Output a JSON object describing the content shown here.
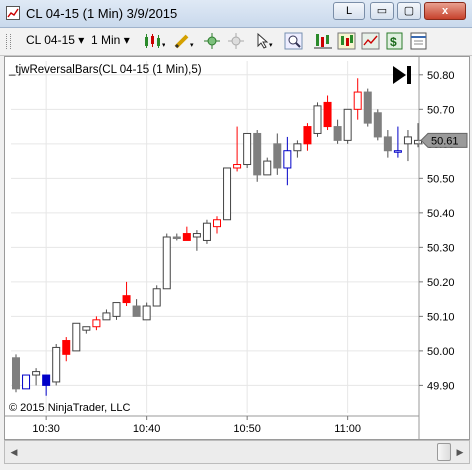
{
  "window": {
    "title": "CL 04-15 (1 Min)  3/9/2015",
    "lock_label": "L",
    "minimize_label": "▭",
    "maximize_label": "▢",
    "close_label": "x"
  },
  "toolbar": {
    "instrument": "CL 04-15",
    "interval": "1 Min",
    "icons": [
      "bar-type-icon",
      "drawing-tools-icon",
      "crosshair-icon",
      "global-crosshair-icon",
      "selection-pointer-icon",
      "zoom-icon",
      "indicators-icon",
      "strategies-icon",
      "chart-properties-icon",
      "dollar-icon",
      "data-box-icon"
    ]
  },
  "chart": {
    "indicator_label": "_tjwReversalBars(CL 04-15 (1 Min),5)",
    "copyright": "© 2015 NinjaTrader, LLC",
    "current_price_label": "50.61",
    "colors": {
      "up_body": "#ffffff",
      "down_body": "#7f7f7f",
      "reversal_up": "#ff0000",
      "reversal_down": "#0000c8",
      "wick": "#505050",
      "grid": "#e6e6e6"
    }
  },
  "chart_data": {
    "type": "candlestick",
    "ylim": [
      49.82,
      50.84
    ],
    "y_ticks": [
      "49.90",
      "50.00",
      "50.10",
      "50.20",
      "50.30",
      "50.40",
      "50.50",
      "50.60",
      "50.70",
      "50.80"
    ],
    "x_ticks": [
      {
        "label": "10:30",
        "bar": 3
      },
      {
        "label": "10:40",
        "bar": 13
      },
      {
        "label": "10:50",
        "bar": 23
      },
      {
        "label": "11:00",
        "bar": 33
      }
    ],
    "bars": [
      {
        "o": 49.98,
        "h": 49.99,
        "l": 49.88,
        "c": 49.89,
        "k": "down"
      },
      {
        "o": 49.89,
        "h": 49.93,
        "l": 49.89,
        "c": 49.93,
        "k": "rev_down"
      },
      {
        "o": 49.93,
        "h": 49.95,
        "l": 49.9,
        "c": 49.94,
        "k": "up"
      },
      {
        "o": 49.93,
        "h": 49.93,
        "l": 49.87,
        "c": 49.9,
        "k": "rev_down"
      },
      {
        "o": 49.91,
        "h": 50.02,
        "l": 49.9,
        "c": 50.01,
        "k": "up"
      },
      {
        "o": 49.99,
        "h": 50.04,
        "l": 49.97,
        "c": 50.03,
        "k": "rev_up"
      },
      {
        "o": 50.0,
        "h": 50.08,
        "l": 50.0,
        "c": 50.08,
        "k": "up"
      },
      {
        "o": 50.06,
        "h": 50.07,
        "l": 50.05,
        "c": 50.07,
        "k": "up"
      },
      {
        "o": 50.07,
        "h": 50.1,
        "l": 50.06,
        "c": 50.09,
        "k": "rev_up"
      },
      {
        "o": 50.09,
        "h": 50.12,
        "l": 50.09,
        "c": 50.11,
        "k": "up"
      },
      {
        "o": 50.1,
        "h": 50.14,
        "l": 50.09,
        "c": 50.14,
        "k": "up"
      },
      {
        "o": 50.14,
        "h": 50.2,
        "l": 50.13,
        "c": 50.16,
        "k": "rev_up"
      },
      {
        "o": 50.13,
        "h": 50.15,
        "l": 50.1,
        "c": 50.1,
        "k": "down"
      },
      {
        "o": 50.09,
        "h": 50.14,
        "l": 50.09,
        "c": 50.13,
        "k": "up"
      },
      {
        "o": 50.13,
        "h": 50.19,
        "l": 50.13,
        "c": 50.18,
        "k": "up"
      },
      {
        "o": 50.18,
        "h": 50.34,
        "l": 50.18,
        "c": 50.33,
        "k": "up"
      },
      {
        "o": 50.33,
        "h": 50.34,
        "l": 50.32,
        "c": 50.33,
        "k": "down"
      },
      {
        "o": 50.32,
        "h": 50.36,
        "l": 50.32,
        "c": 50.34,
        "k": "rev_up"
      },
      {
        "o": 50.33,
        "h": 50.35,
        "l": 50.29,
        "c": 50.34,
        "k": "up"
      },
      {
        "o": 50.32,
        "h": 50.38,
        "l": 50.31,
        "c": 50.37,
        "k": "up"
      },
      {
        "o": 50.36,
        "h": 50.39,
        "l": 50.34,
        "c": 50.38,
        "k": "rev_up"
      },
      {
        "o": 50.38,
        "h": 50.53,
        "l": 50.38,
        "c": 50.53,
        "k": "up"
      },
      {
        "o": 50.53,
        "h": 50.65,
        "l": 50.52,
        "c": 50.54,
        "k": "rev_up"
      },
      {
        "o": 50.54,
        "h": 50.63,
        "l": 50.53,
        "c": 50.63,
        "k": "up"
      },
      {
        "o": 50.63,
        "h": 50.64,
        "l": 50.49,
        "c": 50.51,
        "k": "down"
      },
      {
        "o": 50.51,
        "h": 50.56,
        "l": 50.51,
        "c": 50.55,
        "k": "up"
      },
      {
        "o": 50.6,
        "h": 50.63,
        "l": 50.51,
        "c": 50.53,
        "k": "down"
      },
      {
        "o": 50.53,
        "h": 50.62,
        "l": 50.48,
        "c": 50.58,
        "k": "rev_down"
      },
      {
        "o": 50.58,
        "h": 50.61,
        "l": 50.56,
        "c": 50.6,
        "k": "up"
      },
      {
        "o": 50.6,
        "h": 50.66,
        "l": 50.58,
        "c": 50.65,
        "k": "rev_up"
      },
      {
        "o": 50.63,
        "h": 50.72,
        "l": 50.62,
        "c": 50.71,
        "k": "up"
      },
      {
        "o": 50.72,
        "h": 50.74,
        "l": 50.64,
        "c": 50.65,
        "k": "rev_up"
      },
      {
        "o": 50.65,
        "h": 50.67,
        "l": 50.6,
        "c": 50.61,
        "k": "down"
      },
      {
        "o": 50.61,
        "h": 50.7,
        "l": 50.6,
        "c": 50.7,
        "k": "up"
      },
      {
        "o": 50.7,
        "h": 50.79,
        "l": 50.67,
        "c": 50.75,
        "k": "rev_up"
      },
      {
        "o": 50.75,
        "h": 50.76,
        "l": 50.65,
        "c": 50.66,
        "k": "down"
      },
      {
        "o": 50.69,
        "h": 50.7,
        "l": 50.61,
        "c": 50.62,
        "k": "down"
      },
      {
        "o": 50.62,
        "h": 50.64,
        "l": 50.56,
        "c": 50.58,
        "k": "down"
      },
      {
        "o": 50.58,
        "h": 50.65,
        "l": 50.56,
        "c": 50.58,
        "k": "rev_down"
      },
      {
        "o": 50.6,
        "h": 50.64,
        "l": 50.55,
        "c": 50.62,
        "k": "up"
      },
      {
        "o": 50.6,
        "h": 50.66,
        "l": 50.59,
        "c": 50.61,
        "k": "up"
      }
    ]
  }
}
